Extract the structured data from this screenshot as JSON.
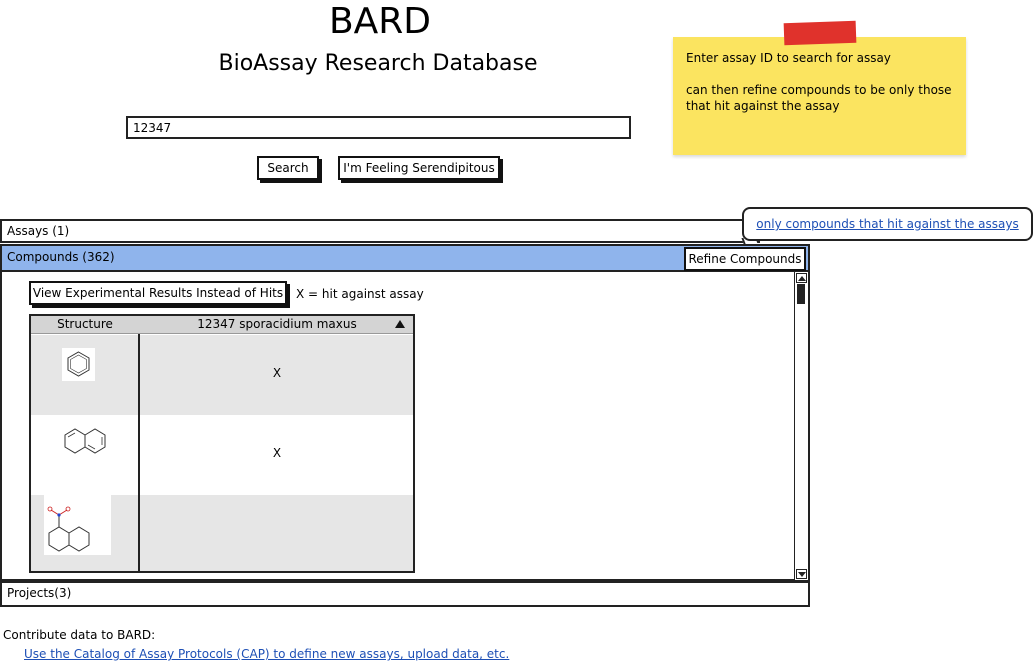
{
  "header": {
    "title": "BARD",
    "subtitle": "BioAssay Research Database"
  },
  "search": {
    "value": "12347",
    "search_label": "Search",
    "lucky_label": "I'm Feeling Serendipitous"
  },
  "sticky_note": {
    "line1": "Enter assay ID to search for assay",
    "line2": "can then refine compounds to be only those",
    "line3": "that hit against the assay",
    "color": "#fbe460"
  },
  "callout": {
    "link_text": "only compounds that hit against the assays"
  },
  "sections": {
    "assays_label": "Assays (1)",
    "compounds_label": "Compounds (362)",
    "projects_label": "Projects(3)",
    "compounds_color": "#8fb4ec"
  },
  "refine_label": "Refine Compounds",
  "panel": {
    "view_button_label": "View Experimental Results Instead of Hits",
    "legend": "X = hit against assay",
    "columns": {
      "structure": "Structure",
      "assay": "12347 sporacidium maxus"
    },
    "rows": [
      {
        "structure_icon": "benzene-structure-icon",
        "hit": "X"
      },
      {
        "structure_icon": "naphthalene-structure-icon",
        "hit": "X"
      },
      {
        "structure_icon": "nitronaphthalene-structure-icon",
        "hit": ""
      }
    ]
  },
  "footer": {
    "contribute": "Contribute data to BARD:",
    "cap_link": "Use the Catalog of Assay Protocols (CAP) to define new assays, upload data, etc."
  }
}
